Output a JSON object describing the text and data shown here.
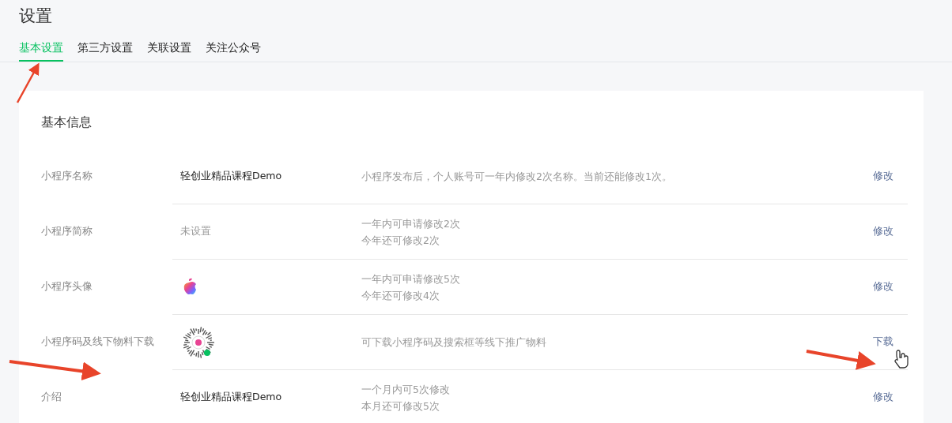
{
  "page": {
    "title": "设置"
  },
  "tabs": [
    {
      "label": "基本设置",
      "selected": true
    },
    {
      "label": "第三方设置",
      "selected": false
    },
    {
      "label": "关联设置",
      "selected": false
    },
    {
      "label": "关注公众号",
      "selected": false
    }
  ],
  "card": {
    "title": "基本信息",
    "rows": [
      {
        "label": "小程序名称",
        "kind": "text",
        "value": "轻创业精品课程Demo",
        "notes": [
          "小程序发布后，个人账号可一年内修改2次名称。当前还能修改1次。"
        ],
        "action": "修改"
      },
      {
        "label": "小程序简称",
        "kind": "unset",
        "value": "未设置",
        "notes": [
          "一年内可申请修改2次",
          "今年还可修改2次"
        ],
        "action": "修改"
      },
      {
        "label": "小程序头像",
        "kind": "avatar",
        "notes": [
          "一年内可申请修改5次",
          "今年还可修改4次"
        ],
        "action": "修改"
      },
      {
        "label": "小程序码及线下物料下载",
        "kind": "code",
        "notes": [
          "可下载小程序码及搜索框等线下推广物料"
        ],
        "action": "下载"
      },
      {
        "label": "介绍",
        "kind": "text",
        "value": "轻创业精品课程Demo",
        "notes": [
          "一个月内可5次修改",
          "本月还可修改5次"
        ],
        "action": "修改"
      }
    ]
  }
}
